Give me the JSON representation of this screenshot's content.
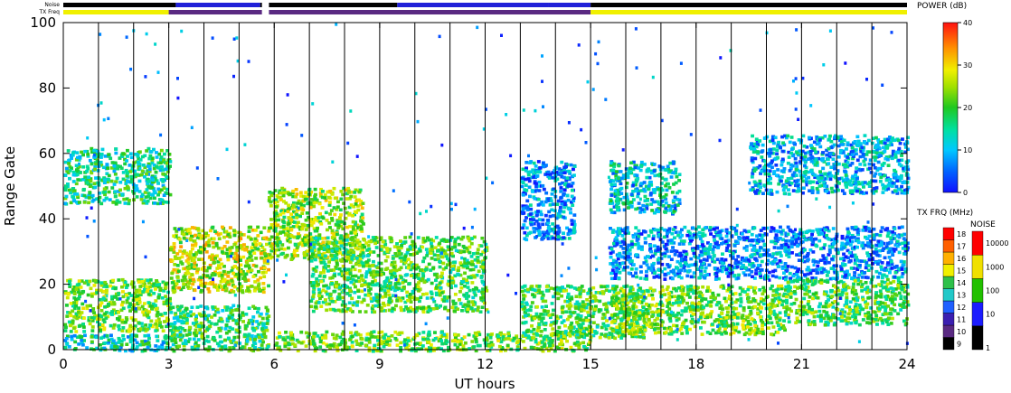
{
  "chart_data": {
    "type": "heatmap",
    "subtype": "range-time-intensity",
    "xlabel": "UT hours",
    "ylabel": "Range Gate",
    "xlim": [
      0,
      24
    ],
    "ylim": [
      0,
      100
    ],
    "x_ticks": [
      0,
      3,
      6,
      9,
      12,
      15,
      18,
      21,
      24
    ],
    "y_ticks": [
      0,
      20,
      40,
      60,
      80,
      100
    ],
    "vertical_grid_interval_hours": 1,
    "status_bars": {
      "noise_label": "Noise",
      "txfreq_label": "TX Freq",
      "noise_segments": [
        {
          "start": 0,
          "end": 3.2,
          "level": "black"
        },
        {
          "start": 3.2,
          "end": 5.6,
          "level": "blue"
        },
        {
          "start": 5.6,
          "end": 9.5,
          "level": "black"
        },
        {
          "start": 9.5,
          "end": 13.8,
          "level": "blue"
        },
        {
          "start": 13.8,
          "end": 15.0,
          "level": "blue"
        },
        {
          "start": 15.0,
          "end": 24,
          "level": "black"
        }
      ],
      "txfreq_segments": [
        {
          "start": 0,
          "end": 3.0,
          "freq_mhz": 15
        },
        {
          "start": 3.0,
          "end": 15.0,
          "freq_mhz": 10
        },
        {
          "start": 15.0,
          "end": 24,
          "freq_mhz": 15
        }
      ],
      "gaps_hours": [
        5.65,
        5.85
      ]
    },
    "power_colorbar": {
      "title": "POWER (dB)",
      "ticks": [
        0,
        10,
        20,
        30,
        40
      ],
      "range": [
        0,
        40
      ]
    },
    "txfreq_colorbar": {
      "title": "TX FRQ (MHz)",
      "ticks": [
        9,
        10,
        11,
        12,
        13,
        14,
        15,
        16,
        17,
        18
      ],
      "colors": [
        "#000000",
        "#5a2a82",
        "#3b1fb0",
        "#2060ff",
        "#22c8c8",
        "#2ec04a",
        "#f0f000",
        "#ffb000",
        "#ff6000",
        "#ff0000"
      ]
    },
    "noise_colorbar": {
      "title": "NOISE",
      "ticks": [
        "1",
        "10",
        "100",
        "1000",
        "10000"
      ],
      "colors": [
        "#000000",
        "#1c1cff",
        "#22c000",
        "#f0e000",
        "#ff0000"
      ]
    },
    "echo_regions": [
      {
        "x": [
          0,
          3
        ],
        "y": [
          45,
          62
        ],
        "power": 16
      },
      {
        "x": [
          0,
          3
        ],
        "y": [
          6,
          22
        ],
        "power": 22
      },
      {
        "x": [
          0,
          3
        ],
        "y": [
          0,
          5
        ],
        "power": 14
      },
      {
        "x": [
          3,
          5.8
        ],
        "y": [
          18,
          38
        ],
        "power": 26
      },
      {
        "x": [
          3,
          5.8
        ],
        "y": [
          0,
          14
        ],
        "power": 18
      },
      {
        "x": [
          5.8,
          8.5
        ],
        "y": [
          28,
          50
        ],
        "power": 24
      },
      {
        "x": [
          7,
          12
        ],
        "y": [
          12,
          35
        ],
        "power": 20
      },
      {
        "x": [
          6,
          15
        ],
        "y": [
          0,
          6
        ],
        "power": 22
      },
      {
        "x": [
          13,
          16.5
        ],
        "y": [
          4,
          20
        ],
        "power": 20
      },
      {
        "x": [
          13,
          14.5
        ],
        "y": [
          34,
          58
        ],
        "power": 8
      },
      {
        "x": [
          15.5,
          20.5
        ],
        "y": [
          5,
          20
        ],
        "power": 22
      },
      {
        "x": [
          15.5,
          24
        ],
        "y": [
          22,
          38
        ],
        "power": 8
      },
      {
        "x": [
          20.5,
          24
        ],
        "y": [
          8,
          22
        ],
        "power": 20
      },
      {
        "x": [
          19.5,
          24
        ],
        "y": [
          48,
          66
        ],
        "power": 10
      },
      {
        "x": [
          15.5,
          17.5
        ],
        "y": [
          42,
          58
        ],
        "power": 12
      }
    ]
  }
}
